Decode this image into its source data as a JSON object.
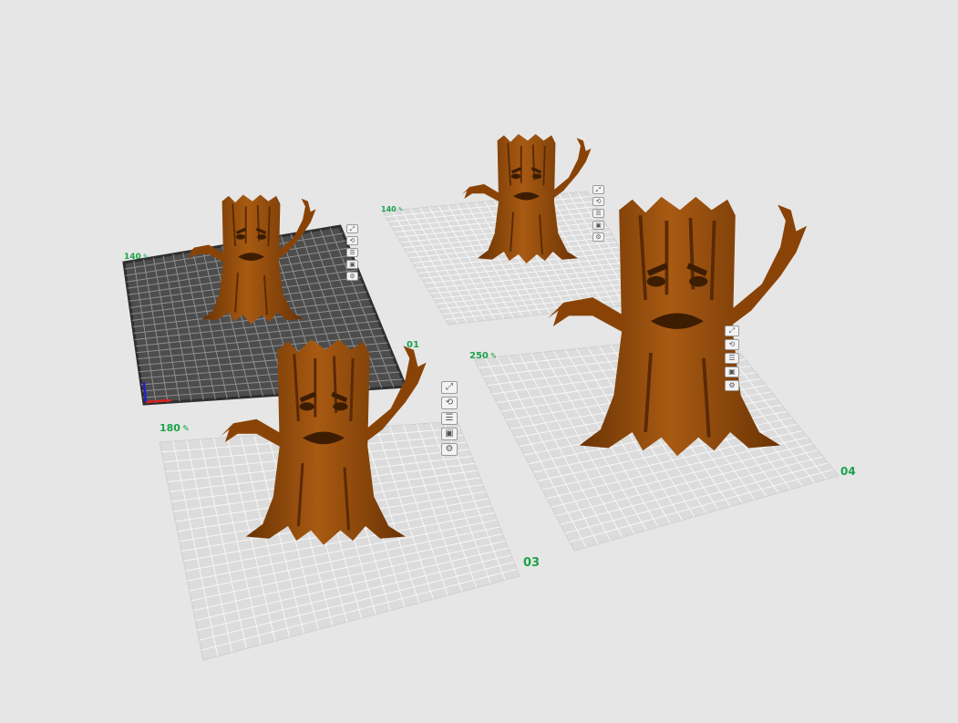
{
  "plates": [
    {
      "id": "01",
      "number_label": "01",
      "height_value": "140",
      "active": true
    },
    {
      "id": "02",
      "number_label": "",
      "height_value": "140",
      "active": false
    },
    {
      "id": "03",
      "number_label": "03",
      "height_value": "180",
      "active": false
    },
    {
      "id": "04",
      "number_label": "04",
      "height_value": "250",
      "active": false
    }
  ],
  "plate_buttons": [
    {
      "name": "arrange-icon",
      "glyph": "⤢"
    },
    {
      "name": "orient-icon",
      "glyph": "⟲"
    },
    {
      "name": "layers-icon",
      "glyph": "☰"
    },
    {
      "name": "lock-icon",
      "glyph": "▣"
    },
    {
      "name": "settings-icon",
      "glyph": "⚙"
    }
  ],
  "edit_icon": "✎",
  "model": {
    "name": "tree-stump-model",
    "color": "#8a4306"
  },
  "colors": {
    "background": "#e6e6e6",
    "active_plate": "#4d4d4d",
    "inactive_plate": "#dcdcdc",
    "grid_light": "#f7f7f7",
    "label_green": "#1aa34a"
  }
}
